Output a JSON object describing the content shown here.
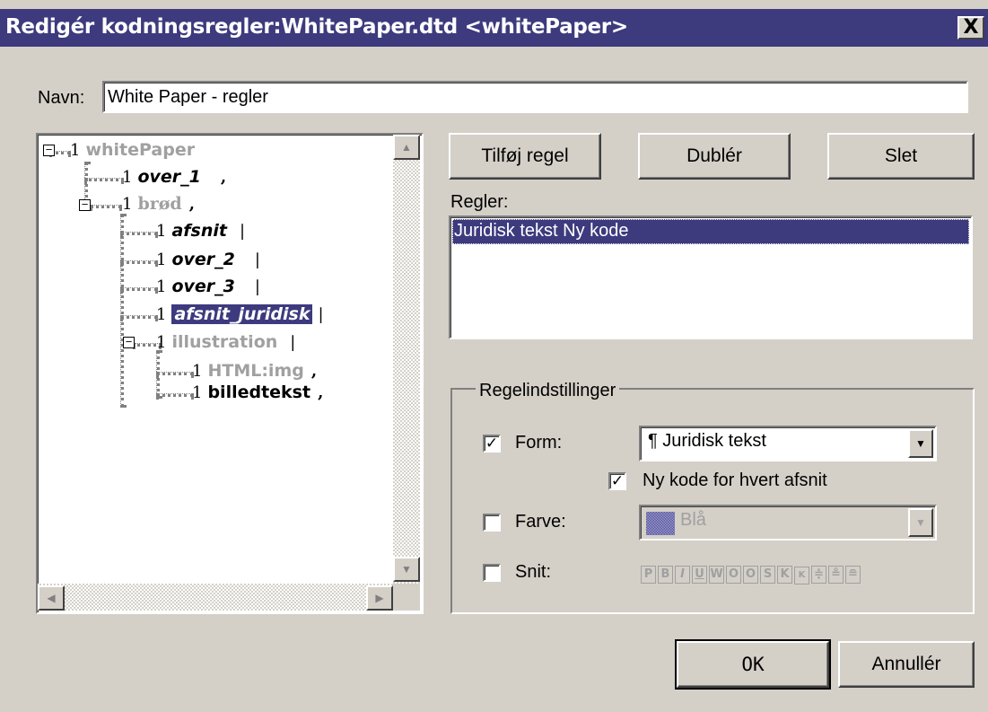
{
  "dialog": {
    "title": "Redigér kodningsregler:WhitePaper.dtd <whitePaper>",
    "close_label": "X"
  },
  "name_field": {
    "label": "Navn:",
    "value": "White Paper - regler"
  },
  "tree": {
    "nodes": [
      {
        "num": "1",
        "name": "whitePaper",
        "sep": ""
      },
      {
        "num": "1",
        "name": "over_1",
        "sep": ","
      },
      {
        "num": "1",
        "name": "brød",
        "sep": ","
      },
      {
        "num": "1",
        "name": "afsnit",
        "sep": "|"
      },
      {
        "num": "1",
        "name": "over_2",
        "sep": "|"
      },
      {
        "num": "1",
        "name": "over_3",
        "sep": "|"
      },
      {
        "num": "1",
        "name": "afsnit_juridisk",
        "sep": "|"
      },
      {
        "num": "1",
        "name": "illustration",
        "sep": "|"
      },
      {
        "num": "1",
        "name": "HTML:img",
        "sep": ","
      },
      {
        "num": "1",
        "name": "billedtekst",
        "sep": ","
      }
    ]
  },
  "buttons": {
    "add_rule": "Tilføj regel",
    "duplicate": "Dublér",
    "delete": "Slet",
    "ok": "OK",
    "cancel": "Annullér"
  },
  "rules": {
    "label": "Regler:",
    "items": [
      "Juridisk tekst Ny kode"
    ]
  },
  "settings": {
    "legend": "Regelindstillinger",
    "form_label": "Form:",
    "form_value": "¶ Juridisk tekst",
    "new_code_label": "Ny kode for hvert afsnit",
    "color_label": "Farve:",
    "color_value": "Blå",
    "cut_label": "Snit:",
    "style_buttons": [
      "P",
      "B",
      "I",
      "U",
      "W",
      "O",
      "O",
      "S",
      "K",
      "K",
      "≑",
      "≗",
      "≘"
    ]
  },
  "colors": {
    "titlebar": "#3d3a7e",
    "selection": "#3d3a7e",
    "dialog_bg": "#d4d0c8"
  }
}
